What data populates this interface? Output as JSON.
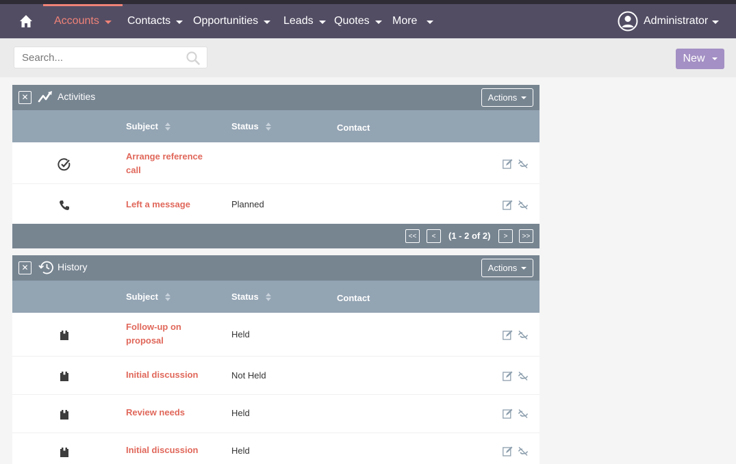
{
  "nav": {
    "items": [
      {
        "label": "Accounts",
        "active": true
      },
      {
        "label": "Contacts"
      },
      {
        "label": "Opportunities"
      },
      {
        "label": "Leads"
      },
      {
        "label": "Quotes"
      },
      {
        "label": "More"
      }
    ],
    "user": "Administrator"
  },
  "search": {
    "placeholder": "Search..."
  },
  "new_button": "New",
  "activities": {
    "title": "Activities",
    "actions_label": "Actions",
    "columns": {
      "subject": "Subject",
      "status": "Status",
      "contact": "Contact"
    },
    "rows": [
      {
        "icon": "task-icon",
        "subject": "Arrange reference call",
        "status": ""
      },
      {
        "icon": "phone-icon",
        "subject": "Left a message",
        "status": "Planned"
      }
    ],
    "pager": {
      "first": "<<",
      "prev": "<",
      "count": "(1 - 2 of 2)",
      "next": ">",
      "last": ">>"
    }
  },
  "history": {
    "title": "History",
    "actions_label": "Actions",
    "columns": {
      "subject": "Subject",
      "status": "Status",
      "contact": "Contact"
    },
    "rows": [
      {
        "icon": "meeting-icon",
        "subject": "Follow-up on proposal",
        "status": "Held"
      },
      {
        "icon": "meeting-icon",
        "subject": "Initial discussion",
        "status": "Not Held"
      },
      {
        "icon": "meeting-icon",
        "subject": "Review needs",
        "status": "Held"
      },
      {
        "icon": "meeting-icon",
        "subject": "Initial discussion",
        "status": "Held"
      }
    ]
  },
  "colors": {
    "nav_bg": "#534d64",
    "accent": "#f08377",
    "link": "#e0675a",
    "panel_head": "#778591",
    "column_head": "#93a4b3",
    "new_button": "#a490c4"
  }
}
